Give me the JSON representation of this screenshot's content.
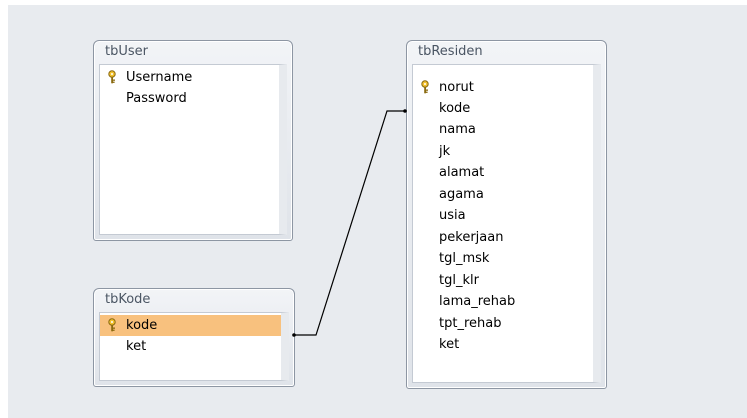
{
  "tables": {
    "user": {
      "title": "tbUser",
      "fields": [
        "Username",
        "Password"
      ]
    },
    "kode": {
      "title": "tbKode",
      "fields": [
        "kode",
        "ket"
      ]
    },
    "residen": {
      "title": "tbResiden",
      "fields": [
        "norut",
        "kode",
        "nama",
        "jk",
        "alamat",
        "agama",
        "usia",
        "pekerjaan",
        "tgl_msk",
        "tgl_klr",
        "lama_rehab",
        "tpt_rehab",
        "ket"
      ]
    }
  },
  "icons": {
    "primary_key": "key-icon"
  },
  "colors": {
    "selected_row": "#f8c17e",
    "canvas": "#e8ebef"
  }
}
